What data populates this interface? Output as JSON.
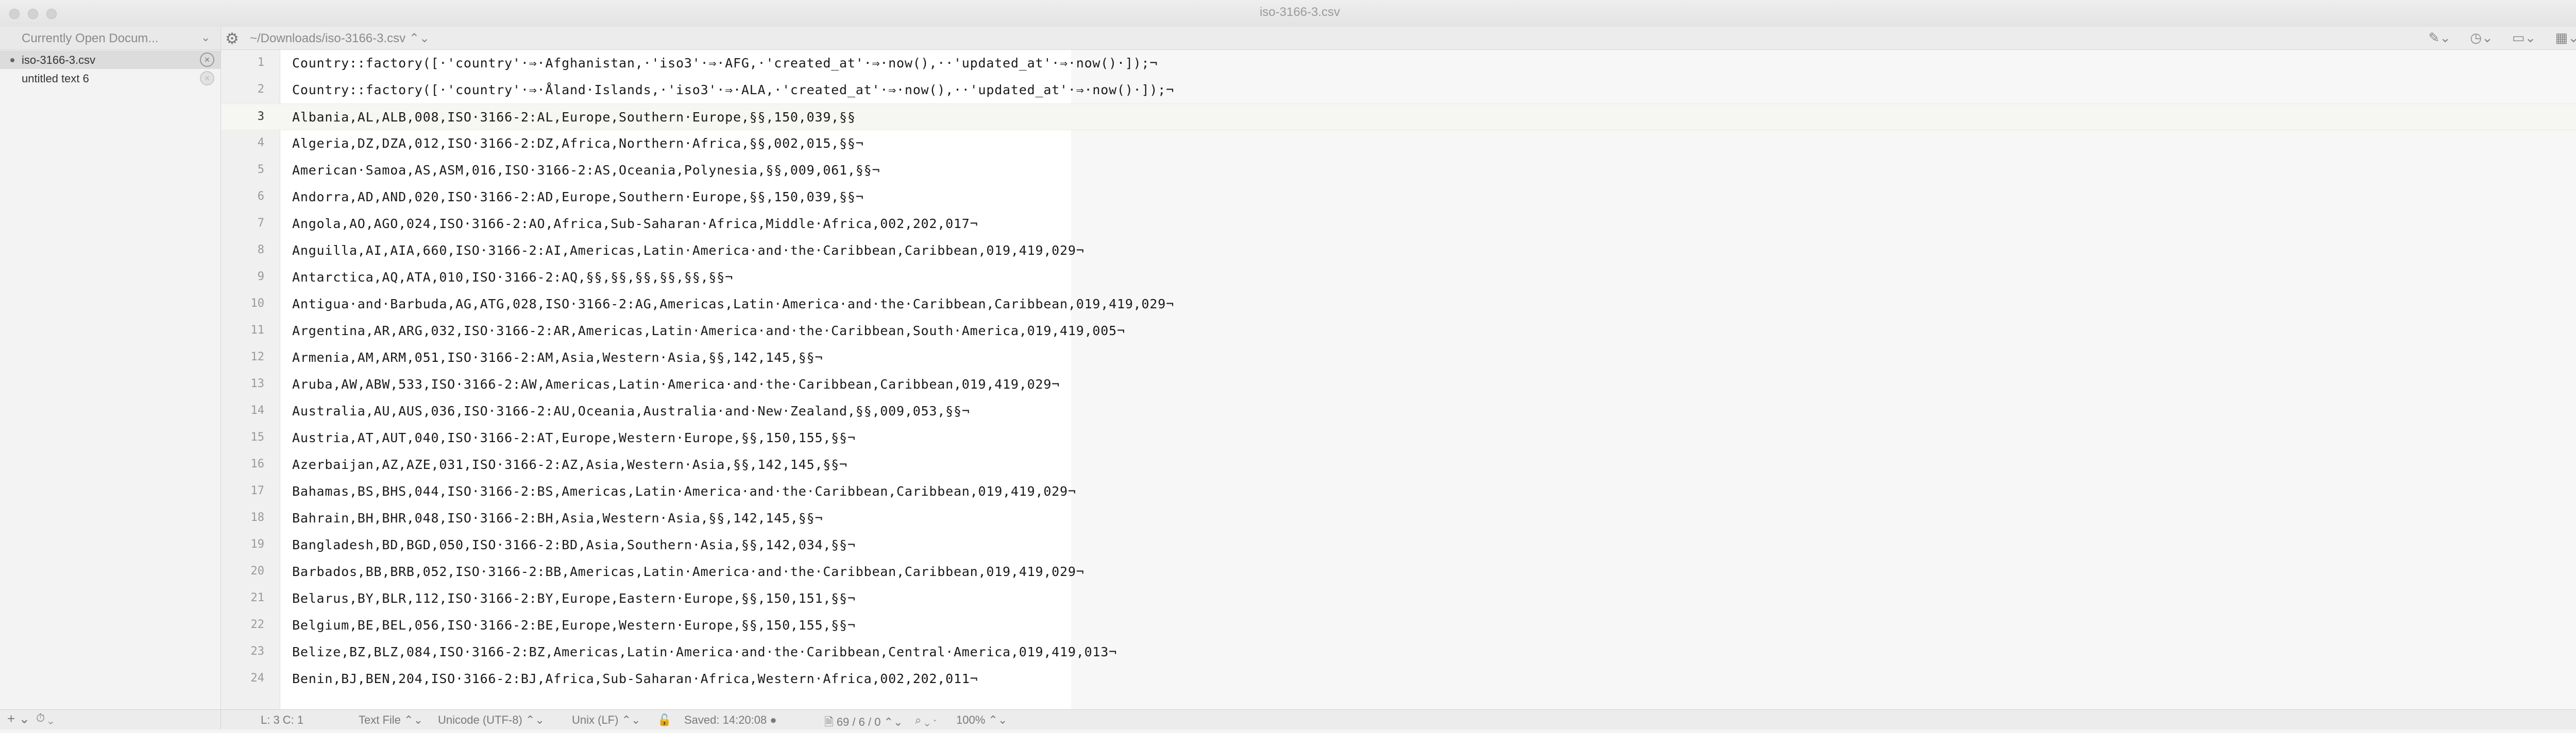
{
  "window": {
    "title": "iso-3166-3.csv"
  },
  "sidebar": {
    "header": "Currently Open Docum...",
    "documents": [
      {
        "name": "iso-3166-3.csv",
        "active": true
      },
      {
        "name": "untitled text 6",
        "active": false
      }
    ],
    "add_label": "+",
    "history_label": "⏱"
  },
  "pathbar": {
    "path": "~/Downloads/iso-3166-3.csv"
  },
  "editor": {
    "current_line": 3,
    "lines": [
      {
        "n": "1",
        "text": "Country::factory([·'country'·⇒·Afghanistan,·'iso3'·⇒·AFG,·'created_at'·⇒·now(),··'updated_at'·⇒·now()·]);¬"
      },
      {
        "n": "2",
        "text": "Country::factory([·'country'·⇒·Åland·Islands,·'iso3'·⇒·ALA,·'created_at'·⇒·now(),··'updated_at'·⇒·now()·]);¬"
      },
      {
        "n": "3",
        "text": "Albania,AL,ALB,008,ISO·3166-2:AL,Europe,Southern·Europe,§§,150,039,§§"
      },
      {
        "n": "4",
        "text": "Algeria,DZ,DZA,012,ISO·3166-2:DZ,Africa,Northern·Africa,§§,002,015,§§¬"
      },
      {
        "n": "5",
        "text": "American·Samoa,AS,ASM,016,ISO·3166-2:AS,Oceania,Polynesia,§§,009,061,§§¬"
      },
      {
        "n": "6",
        "text": "Andorra,AD,AND,020,ISO·3166-2:AD,Europe,Southern·Europe,§§,150,039,§§¬"
      },
      {
        "n": "7",
        "text": "Angola,AO,AGO,024,ISO·3166-2:AO,Africa,Sub-Saharan·Africa,Middle·Africa,002,202,017¬"
      },
      {
        "n": "8",
        "text": "Anguilla,AI,AIA,660,ISO·3166-2:AI,Americas,Latin·America·and·the·Caribbean,Caribbean,019,419,029¬"
      },
      {
        "n": "9",
        "text": "Antarctica,AQ,ATA,010,ISO·3166-2:AQ,§§,§§,§§,§§,§§,§§¬"
      },
      {
        "n": "10",
        "text": "Antigua·and·Barbuda,AG,ATG,028,ISO·3166-2:AG,Americas,Latin·America·and·the·Caribbean,Caribbean,019,419,029¬"
      },
      {
        "n": "11",
        "text": "Argentina,AR,ARG,032,ISO·3166-2:AR,Americas,Latin·America·and·the·Caribbean,South·America,019,419,005¬"
      },
      {
        "n": "12",
        "text": "Armenia,AM,ARM,051,ISO·3166-2:AM,Asia,Western·Asia,§§,142,145,§§¬"
      },
      {
        "n": "13",
        "text": "Aruba,AW,ABW,533,ISO·3166-2:AW,Americas,Latin·America·and·the·Caribbean,Caribbean,019,419,029¬"
      },
      {
        "n": "14",
        "text": "Australia,AU,AUS,036,ISO·3166-2:AU,Oceania,Australia·and·New·Zealand,§§,009,053,§§¬"
      },
      {
        "n": "15",
        "text": "Austria,AT,AUT,040,ISO·3166-2:AT,Europe,Western·Europe,§§,150,155,§§¬"
      },
      {
        "n": "16",
        "text": "Azerbaijan,AZ,AZE,031,ISO·3166-2:AZ,Asia,Western·Asia,§§,142,145,§§¬"
      },
      {
        "n": "17",
        "text": "Bahamas,BS,BHS,044,ISO·3166-2:BS,Americas,Latin·America·and·the·Caribbean,Caribbean,019,419,029¬"
      },
      {
        "n": "18",
        "text": "Bahrain,BH,BHR,048,ISO·3166-2:BH,Asia,Western·Asia,§§,142,145,§§¬"
      },
      {
        "n": "19",
        "text": "Bangladesh,BD,BGD,050,ISO·3166-2:BD,Asia,Southern·Asia,§§,142,034,§§¬"
      },
      {
        "n": "20",
        "text": "Barbados,BB,BRB,052,ISO·3166-2:BB,Americas,Latin·America·and·the·Caribbean,Caribbean,019,419,029¬"
      },
      {
        "n": "21",
        "text": "Belarus,BY,BLR,112,ISO·3166-2:BY,Europe,Eastern·Europe,§§,150,151,§§¬"
      },
      {
        "n": "22",
        "text": "Belgium,BE,BEL,056,ISO·3166-2:BE,Europe,Western·Europe,§§,150,155,§§¬"
      },
      {
        "n": "23",
        "text": "Belize,BZ,BLZ,084,ISO·3166-2:BZ,Americas,Latin·America·and·the·Caribbean,Central·America,019,419,013¬"
      },
      {
        "n": "24",
        "text": "Benin,BJ,BEN,204,ISO·3166-2:BJ,Africa,Sub-Saharan·Africa,Western·Africa,002,202,011¬"
      }
    ]
  },
  "statusbar": {
    "position": "L: 3 C: 1",
    "file_type": "Text File",
    "encoding": "Unicode (UTF-8)",
    "line_endings": "Unix (LF)",
    "saved": "Saved: 14:20:08",
    "counts": "69 / 6 / 0",
    "zoom": "100%"
  }
}
